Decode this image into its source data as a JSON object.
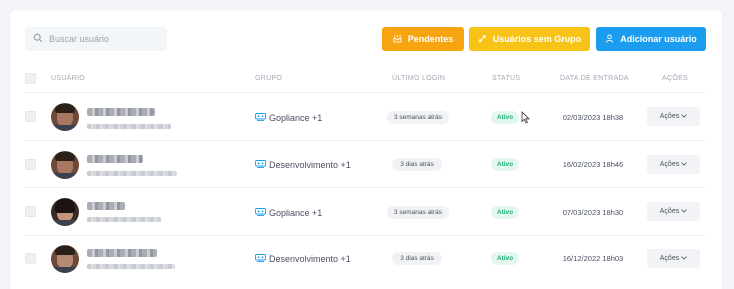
{
  "search": {
    "placeholder": "Buscar usuário"
  },
  "actions": {
    "pendentes": "Pendentes",
    "sem_grupo": "Usuários sem Grupo",
    "adicionar": "Adicionar usuário"
  },
  "table": {
    "headers": {
      "usuario": "USUÁRIO",
      "grupo": "GRUPO",
      "ultimo_login": "ÚLTIMO LOGIN",
      "status": "STATUS",
      "data_entrada": "DATA DE ENTRADA",
      "acoes": "AÇÕES"
    },
    "rows": [
      {
        "grupo": "Gopliance +1",
        "ultimo_login": "3 semanas atrás",
        "status": "Ativo",
        "data_entrada": "02/03/2023 18h38",
        "acoes": "Ações"
      },
      {
        "grupo": "Desenvolvimento +1",
        "ultimo_login": "3 dias atrás",
        "status": "Ativo",
        "data_entrada": "16/02/2023 18h46",
        "acoes": "Ações"
      },
      {
        "grupo": "Gopliance +1",
        "ultimo_login": "3 semanas atrás",
        "status": "Ativo",
        "data_entrada": "07/03/2023 18h30",
        "acoes": "Ações"
      },
      {
        "grupo": "Desenvolvimento +1",
        "ultimo_login": "3 dias atrás",
        "status": "Ativo",
        "data_entrada": "16/12/2022 18h03",
        "acoes": "Ações"
      }
    ]
  },
  "colors": {
    "pendentes": "#f7a411",
    "sem_grupo": "#f7c317",
    "adicionar": "#1a9dee",
    "ativo": "#1fae79"
  },
  "icons": [
    "search-icon",
    "inbox-icon",
    "link-icon",
    "user-icon",
    "group-icon",
    "chevron-down-icon",
    "mouse-cursor-icon"
  ]
}
